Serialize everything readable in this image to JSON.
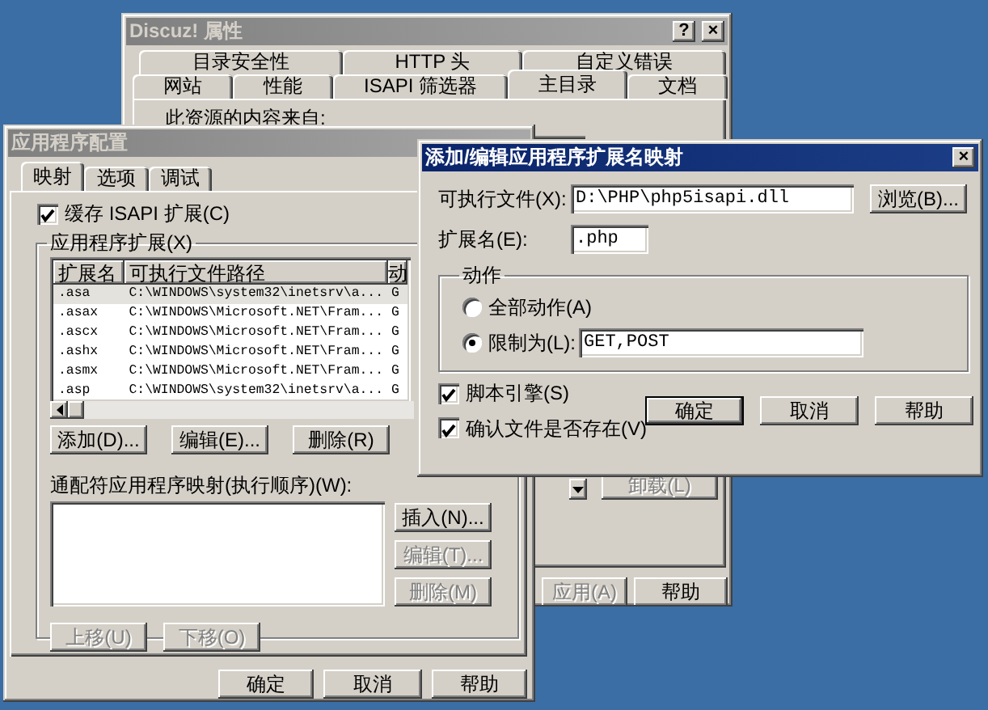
{
  "properties_dialog": {
    "title": "Discuz! 属性",
    "active": false,
    "title_buttons": [
      "?",
      "×"
    ],
    "tab_rows": [
      [
        {
          "label": "目录安全性",
          "selected": false
        },
        {
          "label": "HTTP 头",
          "selected": false
        },
        {
          "label": "自定义错误",
          "selected": false
        }
      ],
      [
        {
          "label": "网站",
          "selected": false
        },
        {
          "label": "性能",
          "selected": false
        },
        {
          "label": "ISAPI 筛选器",
          "selected": false
        },
        {
          "label": "主目录",
          "selected": true
        },
        {
          "label": "文档",
          "selected": false
        }
      ]
    ],
    "content_label": "此资源的内容来自:",
    "unload_button": {
      "label": "卸载(L)",
      "disabled": true
    },
    "buttons": [
      {
        "label": "应用(A)",
        "disabled": true
      },
      {
        "label": "帮助",
        "disabled": false
      }
    ]
  },
  "app_config_dialog": {
    "title": "应用程序配置",
    "active": false,
    "tabs": [
      {
        "label": "映射",
        "selected": true
      },
      {
        "label": "选项",
        "selected": false
      },
      {
        "label": "调试",
        "selected": false
      }
    ],
    "cache_checkbox": {
      "label": "缓存 ISAPI 扩展(C)",
      "checked": true
    },
    "extensions": {
      "label": "应用程序扩展(X)",
      "columns": [
        "扩展名",
        "可执行文件路径",
        "动"
      ],
      "rows": [
        {
          "cells": [
            ".asa",
            "C:\\WINDOWS\\system32\\inetsrv\\a...",
            "G"
          ],
          "selected": true
        },
        {
          "cells": [
            ".asax",
            "C:\\WINDOWS\\Microsoft.NET\\Fram...",
            "G"
          ],
          "selected": false
        },
        {
          "cells": [
            ".ascx",
            "C:\\WINDOWS\\Microsoft.NET\\Fram...",
            "G"
          ],
          "selected": false
        },
        {
          "cells": [
            ".ashx",
            "C:\\WINDOWS\\Microsoft.NET\\Fram...",
            "G"
          ],
          "selected": false
        },
        {
          "cells": [
            ".asmx",
            "C:\\WINDOWS\\Microsoft.NET\\Fram...",
            "G"
          ],
          "selected": false
        },
        {
          "cells": [
            ".asp",
            "C:\\WINDOWS\\system32\\inetsrv\\a...",
            "G"
          ],
          "selected": false
        }
      ],
      "buttons": [
        {
          "label": "添加(D)...",
          "disabled": false
        },
        {
          "label": "编辑(E)...",
          "disabled": false
        },
        {
          "label": "删除(R)",
          "disabled": false
        }
      ]
    },
    "wildcard": {
      "label": "通配符应用程序映射(执行顺序)(W):",
      "side_buttons": [
        {
          "label": "插入(N)...",
          "disabled": false
        },
        {
          "label": "编辑(T)...",
          "disabled": true
        },
        {
          "label": "删除(M)",
          "disabled": true
        }
      ],
      "move_buttons": [
        {
          "label": "上移(U)",
          "disabled": true
        },
        {
          "label": "下移(O)",
          "disabled": true
        }
      ]
    },
    "buttons": [
      {
        "label": "确定",
        "disabled": false
      },
      {
        "label": "取消",
        "disabled": false
      },
      {
        "label": "帮助",
        "disabled": false
      }
    ]
  },
  "mapping_dialog": {
    "title": "添加/编辑应用程序扩展名映射",
    "active": true,
    "close_button": "×",
    "executable": {
      "label": "可执行文件(X):",
      "value": "D:\\PHP\\php5isapi.dll"
    },
    "browse_button": "浏览(B)...",
    "extension": {
      "label": "扩展名(E):",
      "value": ".php"
    },
    "action_group": {
      "label": "动作",
      "options": [
        {
          "label": "全部动作(A)",
          "selected": false
        },
        {
          "label": "限制为(L):",
          "selected": true
        }
      ],
      "limit_value": "GET,POST"
    },
    "checkboxes": [
      {
        "label": "脚本引擎(S)",
        "checked": true
      },
      {
        "label": "确认文件是否存在(V)",
        "checked": true
      }
    ],
    "buttons": [
      {
        "label": "确定",
        "default": true
      },
      {
        "label": "取消",
        "default": false
      },
      {
        "label": "帮助",
        "default": false
      }
    ]
  }
}
